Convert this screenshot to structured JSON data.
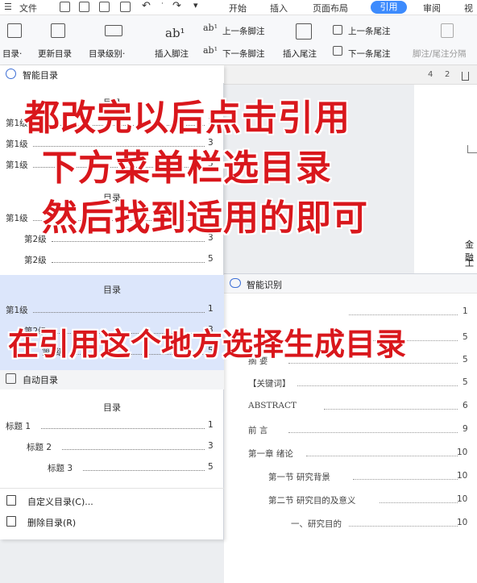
{
  "menubar": {
    "file_label": "文件",
    "tabs": [
      "开始",
      "插入",
      "页面布局",
      "引用",
      "审阅",
      "视"
    ],
    "active_tab": "引用"
  },
  "ribbon": {
    "toc_label": "目录·",
    "update_toc": "更新目录",
    "toc_level": "目录级别·",
    "insert_footnote": "插入脚注",
    "prev_footnote": "上一条脚注",
    "next_footnote": "下一条脚注",
    "insert_endnote": "插入尾注",
    "prev_endnote": "上一条尾注",
    "next_endnote": "下一条尾注",
    "separator_label": "脚注/尾注分隔"
  },
  "ruler": {
    "n4": "4",
    "n2": "2"
  },
  "dropdown": {
    "smart_toc_header": "智能目录",
    "cards": [
      {
        "title": "目录",
        "lines": [
          {
            "text": "第1级",
            "page": "1"
          },
          {
            "text": "第1级",
            "page": "3"
          },
          {
            "text": "第1级",
            "page": "5"
          }
        ]
      },
      {
        "title": "目录",
        "lines": [
          {
            "text": "第1级",
            "page": "1"
          },
          {
            "text": "第2级",
            "page": "3"
          },
          {
            "text": "第2级",
            "page": "5"
          }
        ]
      },
      {
        "title": "目录",
        "lines": [
          {
            "text": "第1级",
            "page": "1"
          },
          {
            "text": "第2级",
            "page": "3"
          },
          {
            "text": "第3级",
            "page": "5"
          }
        ]
      }
    ],
    "auto_toc_header": "自动目录",
    "auto_card": {
      "title": "目录",
      "lines": [
        {
          "text": "标题 1",
          "page": "1"
        },
        {
          "text": "标题 2",
          "page": "3"
        },
        {
          "text": "标题 3",
          "page": "5"
        }
      ]
    },
    "custom_toc": "自定义目录(C)...",
    "delete_toc": "删除目录(R)"
  },
  "smart_recognition": {
    "header": "智能识别",
    "lines": [
      {
        "text": "",
        "page": "1"
      },
      {
        "text": "",
        "page": "5"
      },
      {
        "text": "摘  要",
        "page": "5"
      },
      {
        "text": "【关键词】",
        "page": "5"
      },
      {
        "text": "ABSTRACT",
        "page": "6"
      },
      {
        "text": "前  言",
        "page": "9"
      },
      {
        "text": "第一章 绪论",
        "page": "10"
      },
      {
        "text": "第一节  研究背景",
        "page": "10"
      },
      {
        "text": "第二节  研究目的及意义",
        "page": "10"
      },
      {
        "text": "一、研究目的",
        "page": "10"
      }
    ]
  },
  "document": {
    "line1": "金融",
    "line2": "工"
  },
  "overlay": {
    "line1": "都改完以后点击引用",
    "line2": "下方菜单栏选目录",
    "line3": "然后找到适用的即可",
    "line4": "在引用这个地方选择生成目录"
  },
  "colors": {
    "accent": "#3d8bfd",
    "overlay_red": "#d9171c",
    "selected_card": "#dce6fb"
  }
}
